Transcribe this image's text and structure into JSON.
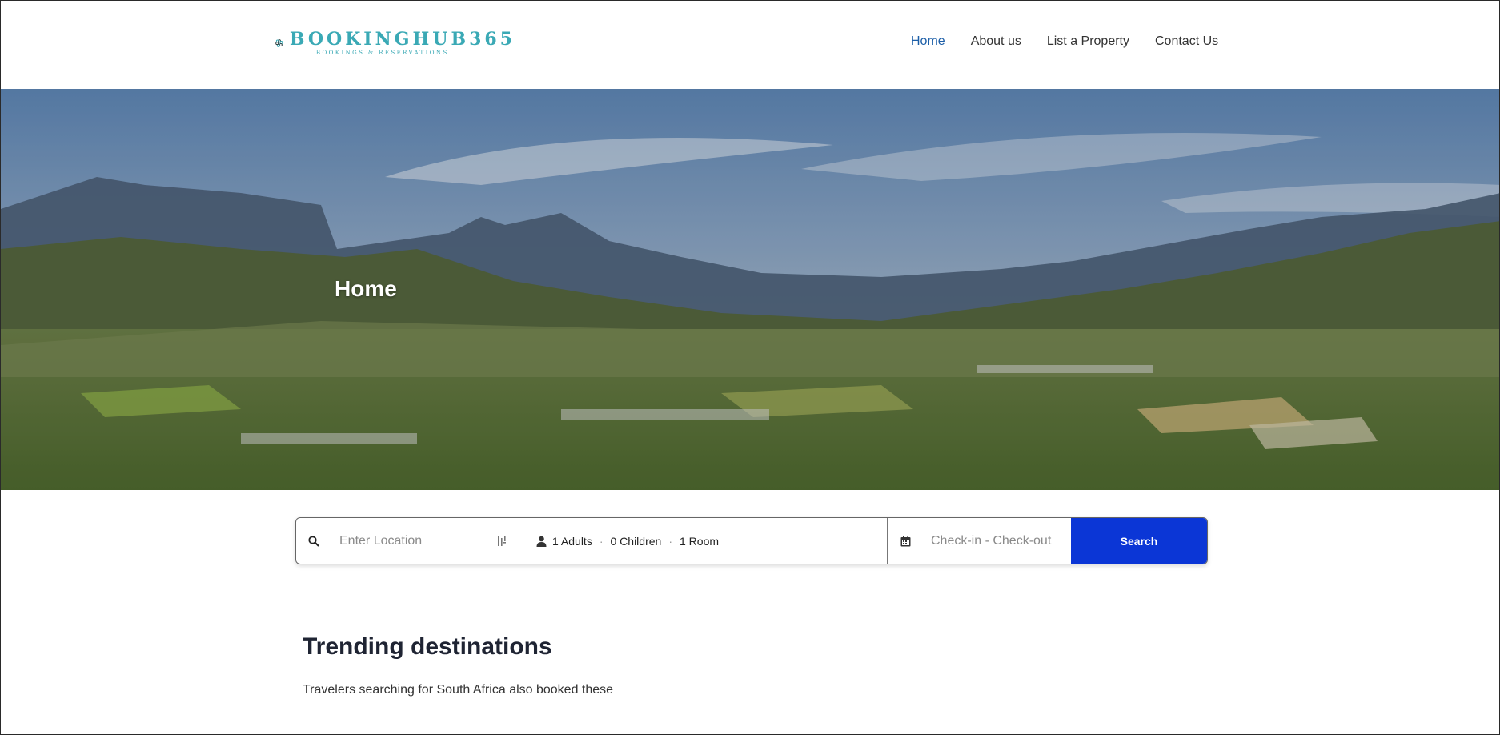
{
  "brand": {
    "name": "BOOKINGHUB365",
    "tagline": "BOOKINGS & RESERVATIONS",
    "accent_color": "#3aa9b5"
  },
  "nav": {
    "items": [
      {
        "label": "Home",
        "active": true
      },
      {
        "label": "About us",
        "active": false
      },
      {
        "label": "List a Property",
        "active": false
      },
      {
        "label": "Contact Us",
        "active": false
      }
    ],
    "active_color": "#1d5fa8"
  },
  "hero": {
    "title": "Home",
    "image": "mountain-valley-landscape"
  },
  "search": {
    "location_placeholder": "Enter Location",
    "adults": "1 Adults",
    "children": "0 Children",
    "rooms": "1 Room",
    "dates_placeholder": "Check-in - Check-out",
    "button_label": "Search",
    "button_color": "#0b36d6",
    "icons": {
      "location": "search-icon",
      "locate": "crosshair-icon",
      "guests": "user-icon",
      "dates": "calendar-icon"
    }
  },
  "trending": {
    "title": "Trending destinations",
    "subtitle": "Travelers searching for South Africa also booked these"
  }
}
